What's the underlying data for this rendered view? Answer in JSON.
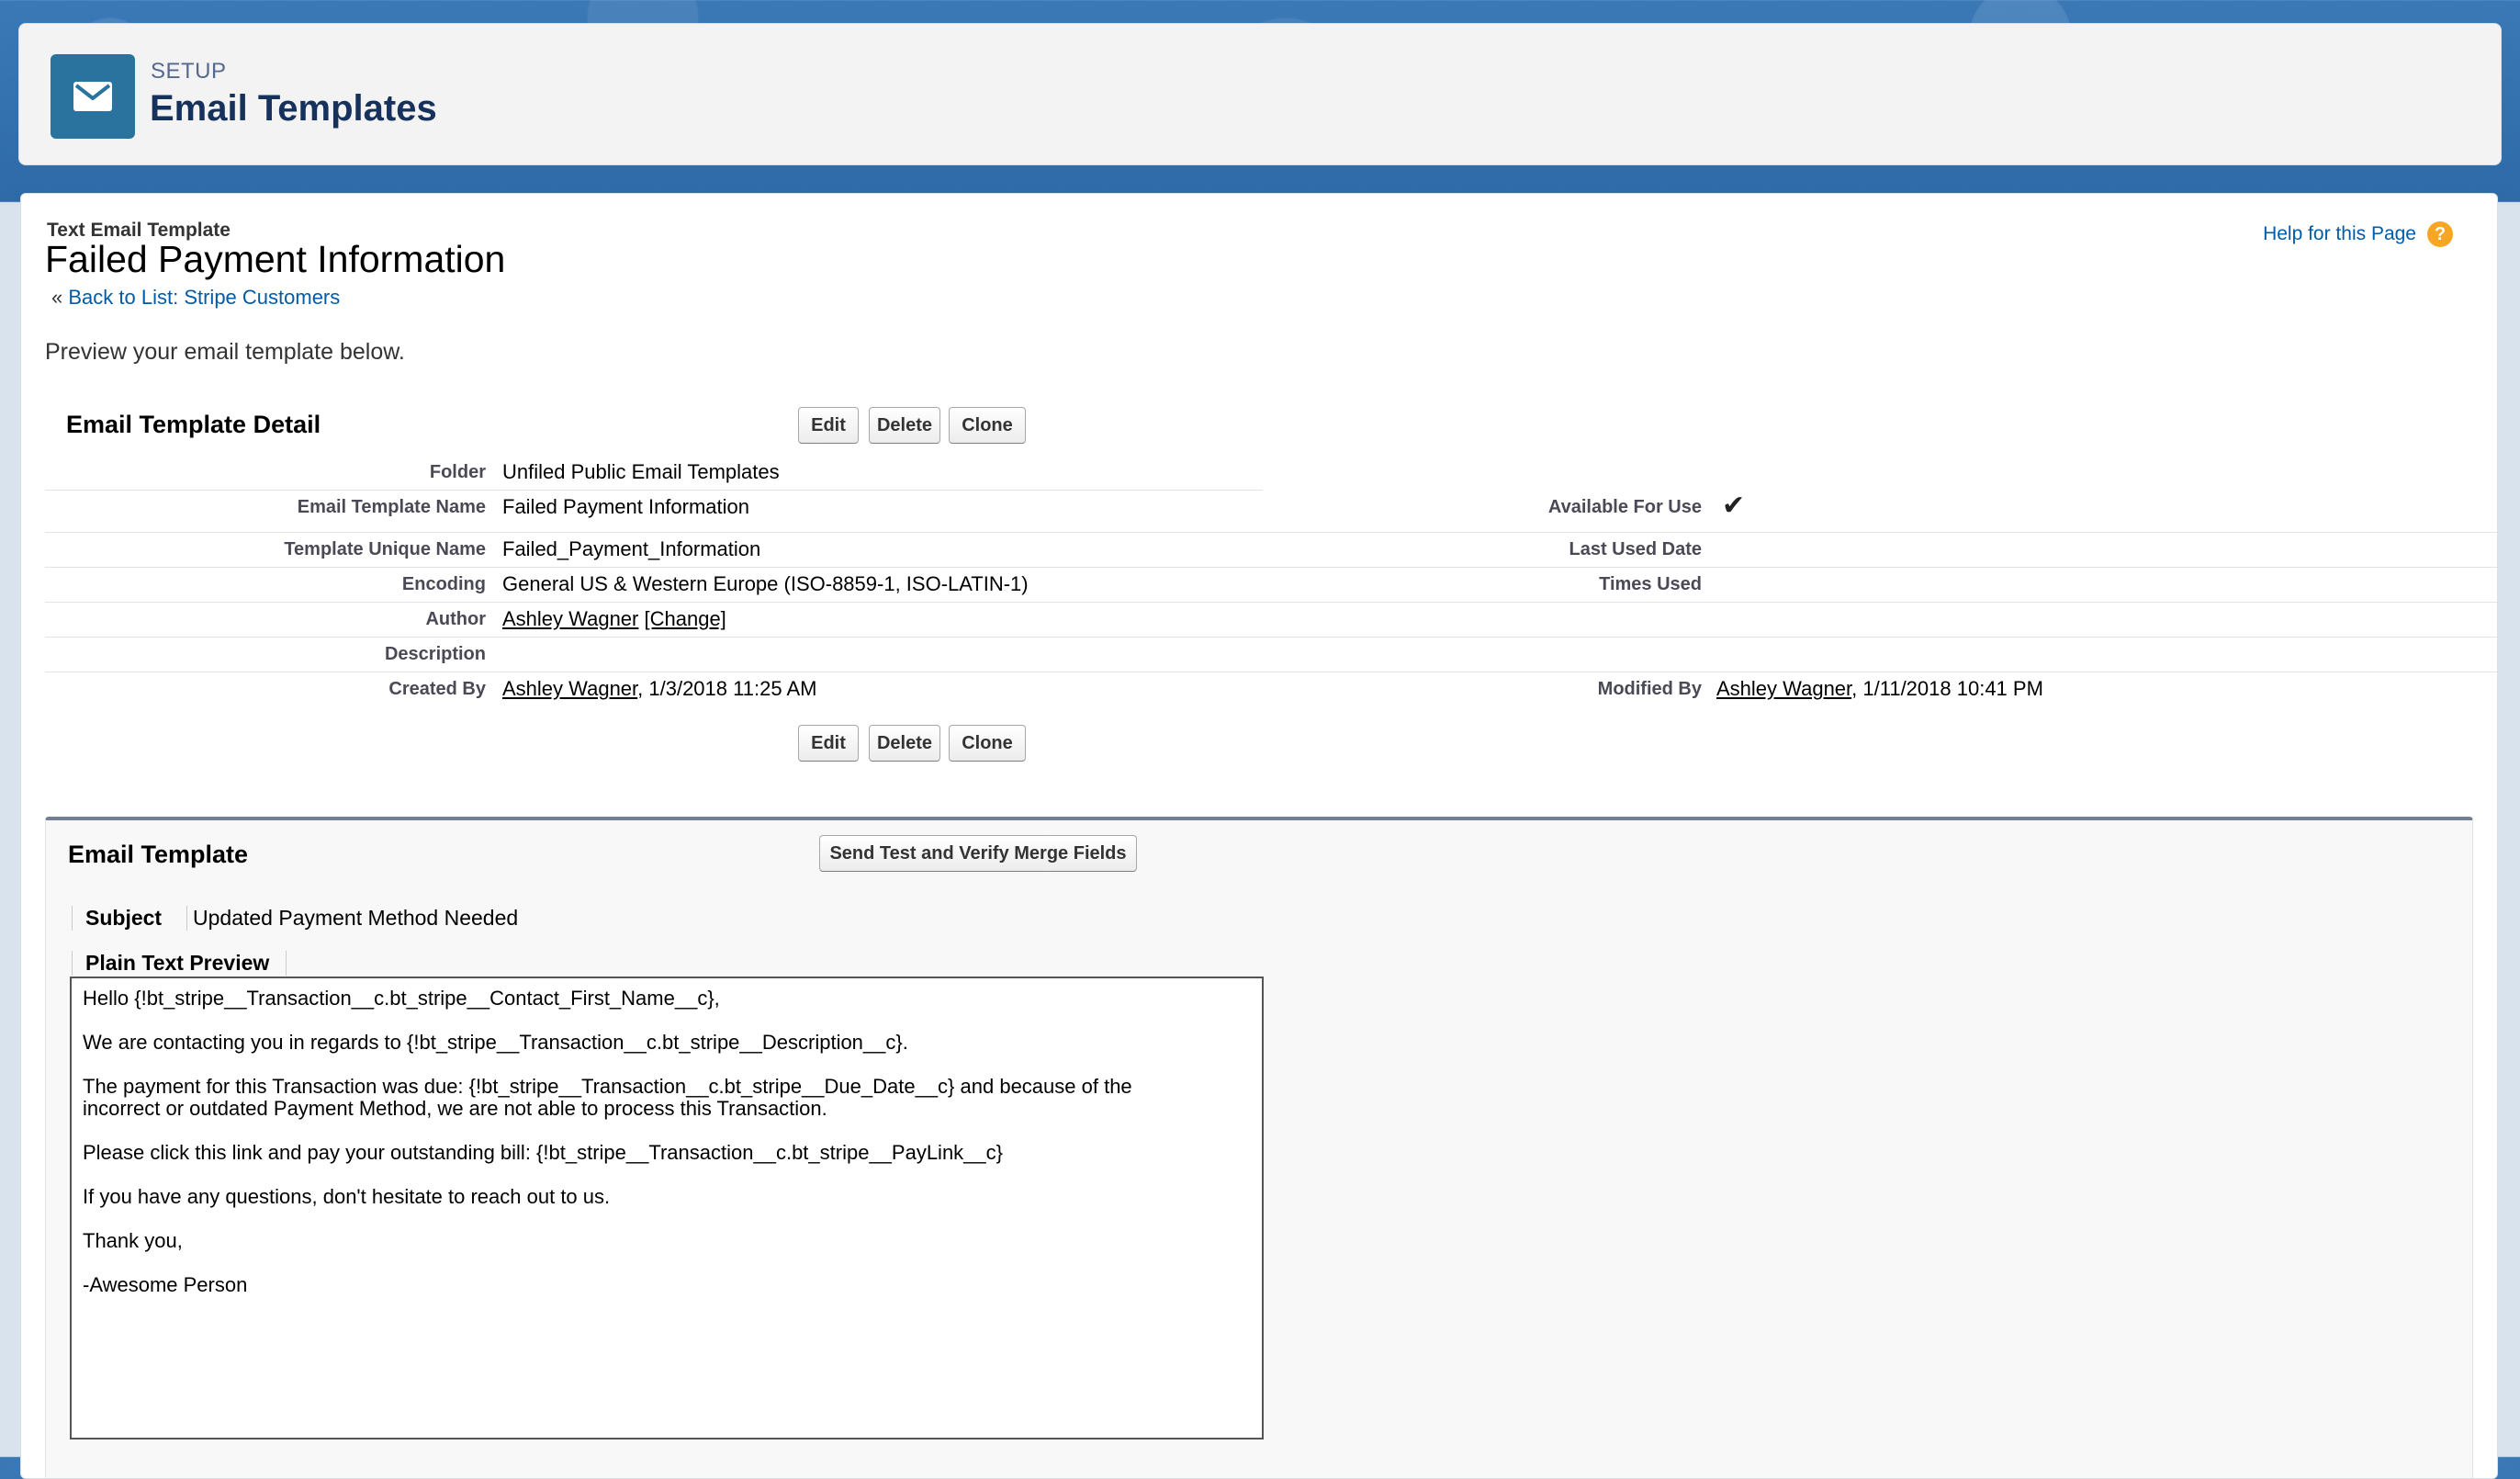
{
  "header": {
    "setup_label": "SETUP",
    "title": "Email Templates",
    "icon": "envelope-icon",
    "accent_color": "#2a739e"
  },
  "page": {
    "type_label": "Text Email Template",
    "title": "Failed Payment Information",
    "back_prefix": "«",
    "back_link": "Back to List: Stripe Customers",
    "help_link": "Help for this Page",
    "help_icon": "?",
    "intro": "Preview your email template below."
  },
  "detail": {
    "section_title": "Email Template Detail",
    "buttons": {
      "edit": "Edit",
      "delete": "Delete",
      "clone": "Clone"
    },
    "folder_label": "Folder",
    "folder_value": "Unfiled Public Email Templates",
    "name_label": "Email Template Name",
    "name_value": "Failed Payment Information",
    "available_label": "Available For Use",
    "available_value": "✔",
    "unique_label": "Template Unique Name",
    "unique_value": "Failed_Payment_Information",
    "last_used_label": "Last Used Date",
    "encoding_label": "Encoding",
    "encoding_value": "General US & Western Europe (ISO-8859-1, ISO-LATIN-1)",
    "times_used_label": "Times Used",
    "author_label": "Author",
    "author_name": "Ashley Wagner",
    "author_change": "[Change]",
    "description_label": "Description",
    "created_label": "Created By",
    "created_name": "Ashley Wagner",
    "created_date": ", 1/3/2018 11:25 AM",
    "modified_label": "Modified By",
    "modified_name": "Ashley Wagner",
    "modified_date": ", 1/11/2018 10:41 PM"
  },
  "template": {
    "section_title": "Email Template",
    "send_test_button": "Send Test and Verify Merge Fields",
    "subject_label": "Subject",
    "subject_value": "Updated Payment Method Needed",
    "preview_label": "Plain Text Preview",
    "body": [
      "Hello {!bt_stripe__Transaction__c.bt_stripe__Contact_First_Name__c},",
      "We are contacting you in regards to {!bt_stripe__Transaction__c.bt_stripe__Description__c}.",
      "The payment for this Transaction was due: {!bt_stripe__Transaction__c.bt_stripe__Due_Date__c} and because of the",
      "incorrect or outdated Payment Method, we are not able to process this Transaction.",
      "Please click this link and pay your outstanding bill: {!bt_stripe__Transaction__c.bt_stripe__PayLink__c}",
      "If you have any questions, don't hesitate to reach out to us.",
      "Thank you,",
      "-Awesome Person"
    ]
  }
}
